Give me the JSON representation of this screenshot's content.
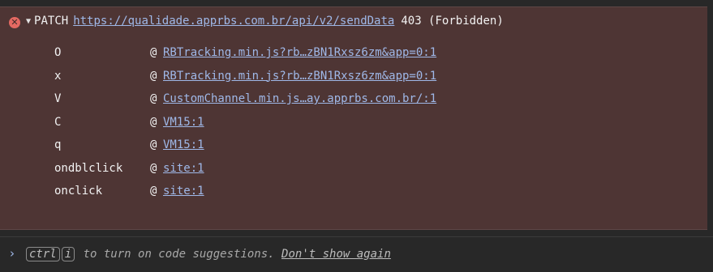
{
  "error": {
    "icon": "error-x-icon",
    "expand_glyph": "▼",
    "method": "PATCH",
    "url": "https://qualidade.apprbs.com.br/api/v2/sendData",
    "status": "403 (Forbidden)"
  },
  "stack_frames": [
    {
      "fn": "O",
      "at": "@",
      "source": "RBTracking.min.js?rb…zBN1Rxsz6zm&app=0:1"
    },
    {
      "fn": "x",
      "at": "@",
      "source": "RBTracking.min.js?rb…zBN1Rxsz6zm&app=0:1"
    },
    {
      "fn": "V",
      "at": "@",
      "source": "CustomChannel.min.js…ay.apprbs.com.br/:1"
    },
    {
      "fn": "C",
      "at": "@",
      "source": "VM15:1"
    },
    {
      "fn": "q",
      "at": "@",
      "source": "VM15:1"
    },
    {
      "fn": "ondblclick",
      "at": "@",
      "source": "site:1"
    },
    {
      "fn": "onclick",
      "at": "@",
      "source": "site:1"
    }
  ],
  "prompt": {
    "chevron": "›",
    "key1": "ctrl",
    "key2": "i",
    "text": " to turn on code suggestions. ",
    "dismiss_link": "Don't show again"
  },
  "colors": {
    "error_background": "#4e3534",
    "error_icon": "#e46962",
    "link": "#9fb8e8"
  }
}
